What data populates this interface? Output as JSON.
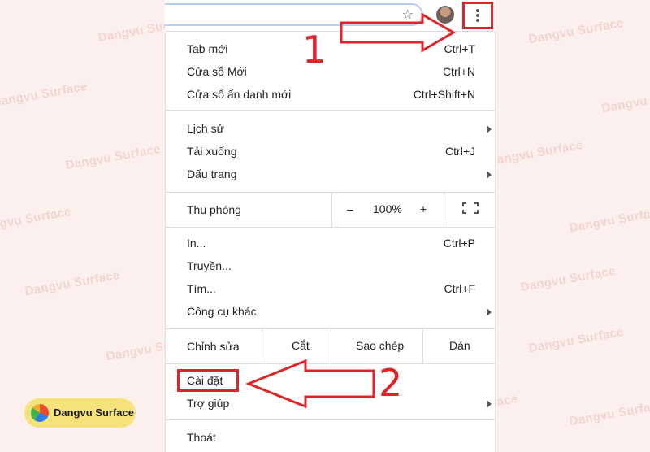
{
  "watermark": {
    "text": "Dangvu Surface",
    "brand_text": "Dangvu Surface"
  },
  "toolbar": {
    "star_icon": "star-icon",
    "menu_icon": "three-dots-vertical-icon"
  },
  "menu": {
    "group1": [
      {
        "label": "Tab mới",
        "shortcut": "Ctrl+T"
      },
      {
        "label": "Cửa sổ Mới",
        "shortcut": "Ctrl+N"
      },
      {
        "label": "Cửa sổ ẩn danh mới",
        "shortcut": "Ctrl+Shift+N"
      }
    ],
    "group2": [
      {
        "label": "Lịch sử",
        "shortcut": ""
      },
      {
        "label": "Tải xuống",
        "shortcut": "Ctrl+J"
      },
      {
        "label": "Dấu trang",
        "shortcut": ""
      }
    ],
    "zoom": {
      "label": "Thu phóng",
      "minus": "–",
      "value": "100%",
      "plus": "+"
    },
    "group3": [
      {
        "label": "In...",
        "shortcut": "Ctrl+P"
      },
      {
        "label": "Truyền...",
        "shortcut": ""
      },
      {
        "label": "Tìm...",
        "shortcut": "Ctrl+F"
      },
      {
        "label": "Công cụ khác",
        "shortcut": ""
      }
    ],
    "edit": {
      "label": "Chỉnh sửa",
      "cut": "Cắt",
      "copy": "Sao chép",
      "paste": "Dán"
    },
    "group4": [
      {
        "label": "Cài đặt",
        "shortcut": ""
      },
      {
        "label": "Trợ giúp",
        "shortcut": ""
      }
    ],
    "exit": {
      "label": "Thoát"
    }
  },
  "annotations": {
    "step1": "1",
    "step2": "2",
    "color": "#e0242b"
  }
}
